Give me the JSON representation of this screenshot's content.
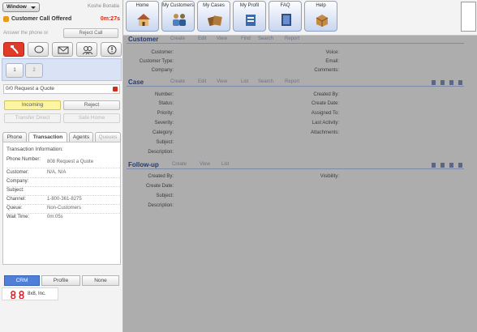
{
  "window_button": "Window",
  "agent_name": "Koshe Bonatia",
  "call": {
    "status": "Customer Call Offered",
    "timer": "0m:27s"
  },
  "answer_line": "Answer the phone or",
  "reject_call": "Reject Call",
  "toolbar_icons": [
    "phone-tool-icon",
    "chat-tool-icon",
    "email-tool-icon",
    "group-tool-icon",
    "info-tool-icon"
  ],
  "line_tabs": [
    "1",
    "2"
  ],
  "subject": "0/0 Request a Quote",
  "actions": {
    "accept": "Incoming",
    "reject": "Reject",
    "transfer": "Transfer Direct",
    "conference": "Safe Home"
  },
  "detail_tabs": [
    "Phone",
    "Transaction",
    "Agents",
    "Queues"
  ],
  "transaction": {
    "title": "Transaction Information:",
    "rows": [
      {
        "k": "Phone Number:",
        "v": "808 Request a Quote"
      },
      {
        "k": "Customer:",
        "v": "N/A, N/A"
      },
      {
        "k": "Company:",
        "v": ""
      },
      {
        "k": "Subject:",
        "v": ""
      },
      {
        "k": "Channel:",
        "v": "1-800-361-8275"
      },
      {
        "k": "Queue:",
        "v": "Non-Customers"
      },
      {
        "k": "Wait Time:",
        "v": "0m:05s"
      }
    ]
  },
  "bottom_tabs": [
    "CRM",
    "Profile",
    "None"
  ],
  "brand": "8x8, Inc.",
  "nav_buttons": [
    "Home",
    "My Customers",
    "My Cases",
    "My Profil",
    "FAQ",
    "Help"
  ],
  "customer": {
    "title": "Customer",
    "links": [
      "Create",
      "Edit",
      "View",
      "Find",
      "Search",
      "Report"
    ],
    "left_fields": [
      "Customer:",
      "Customer Type:",
      "Company:"
    ],
    "right_fields": [
      "Voice:",
      "Email:",
      "Comments:"
    ]
  },
  "case": {
    "title": "Case",
    "links": [
      "Create",
      "Edit",
      "View",
      "List",
      "Search",
      "Report"
    ],
    "left_fields": [
      "Number:",
      "Status:",
      "Priority:",
      "Severity:",
      "Category:",
      "Subject:",
      "Description:"
    ],
    "right_fields": [
      "Created By:",
      "Create Date:",
      "Assigned To:",
      "Last Activity:",
      "Attachments:"
    ]
  },
  "followup": {
    "title": "Follow-up",
    "links": [
      "Create",
      "View",
      "List"
    ],
    "left_fields": [
      "Created By:",
      "Create Date:",
      "Subject:",
      "Description:"
    ],
    "right_fields": [
      "Visibility:"
    ]
  },
  "colors": {
    "accent": "#e23a2a",
    "call_timer": "#d12a10",
    "accept_bg": "#fbf4a0",
    "section_title": "#243a72",
    "selected_tab": "#4f7fd8"
  }
}
